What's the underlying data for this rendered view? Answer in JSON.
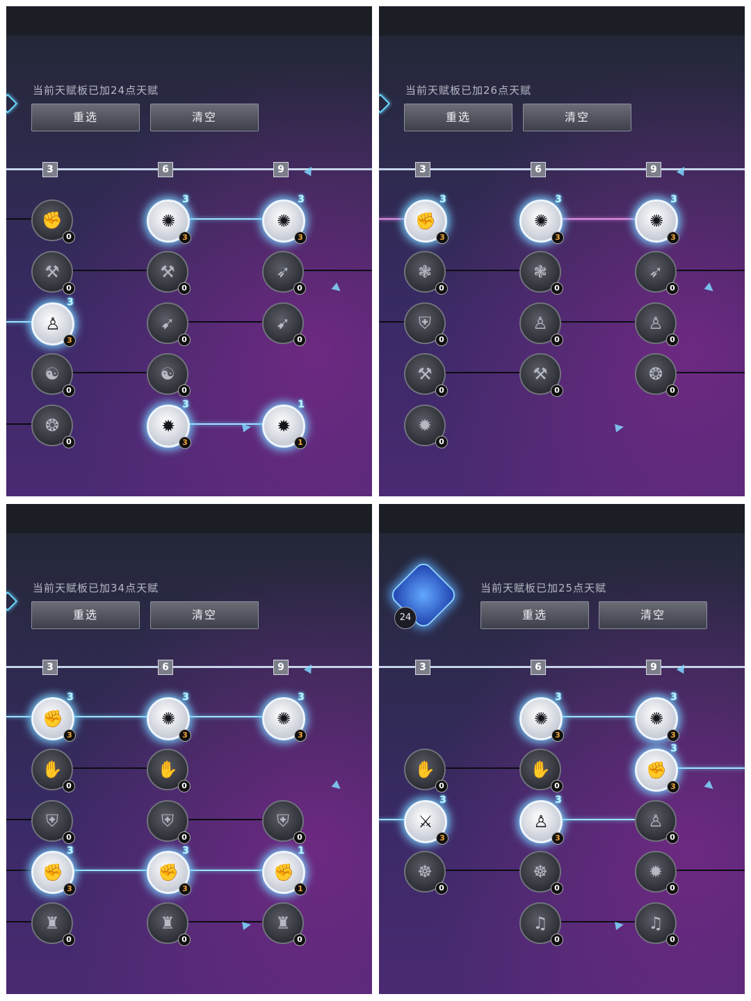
{
  "panels": [
    {
      "id": "p1",
      "talent_total": "当前天赋板已加24点天赋",
      "reselect_label": "重选",
      "clear_label": "清空",
      "tiers": [
        "3",
        "6",
        "9"
      ],
      "has_emblem": false,
      "rows": [
        {
          "nodes": [
            {
              "col": 0,
              "icon": "fist-icon",
              "points": "0",
              "max": ""
            },
            {
              "col": 1,
              "icon": "thorn-burst-icon",
              "points": "3",
              "max": "3"
            },
            {
              "col": 2,
              "icon": "thorn-burst-icon",
              "points": "3",
              "max": "3"
            }
          ],
          "links": [
            {
              "from": 1,
              "to": 2,
              "style": "glow"
            }
          ],
          "in": true
        },
        {
          "nodes": [
            {
              "col": 0,
              "icon": "dash-strike-icon",
              "points": "0",
              "max": ""
            },
            {
              "col": 1,
              "icon": "dash-strike-icon",
              "points": "0",
              "max": ""
            },
            {
              "col": 2,
              "icon": "sweep-icon",
              "points": "0",
              "max": ""
            }
          ],
          "links": [
            {
              "from": 0,
              "to": 1,
              "style": "dark"
            }
          ],
          "out": true
        },
        {
          "nodes": [
            {
              "col": 0,
              "icon": "meditate-icon",
              "points": "3",
              "max": "3"
            },
            {
              "col": 1,
              "icon": "arrow-target-icon",
              "points": "0",
              "max": ""
            },
            {
              "col": 2,
              "icon": "arrow-target-icon",
              "points": "0",
              "max": ""
            }
          ],
          "links": [
            {
              "from": 1,
              "to": 2,
              "style": "dark"
            }
          ],
          "in": true,
          "in_style": "glow"
        },
        {
          "nodes": [
            {
              "col": 0,
              "icon": "whirl-icon",
              "points": "0",
              "max": ""
            },
            {
              "col": 1,
              "icon": "whirl-icon",
              "points": "0",
              "max": ""
            }
          ],
          "links": [
            {
              "from": 0,
              "to": 1,
              "style": "dark"
            }
          ]
        },
        {
          "nodes": [
            {
              "col": 0,
              "icon": "cycle-icon",
              "points": "0",
              "max": ""
            },
            {
              "col": 1,
              "icon": "impact-icon",
              "points": "3",
              "max": "3"
            },
            {
              "col": 2,
              "icon": "impact-icon",
              "points": "1",
              "max": "1"
            }
          ],
          "links": [
            {
              "from": 1,
              "to": 2,
              "style": "glow"
            }
          ],
          "in": true
        }
      ]
    },
    {
      "id": "p2",
      "talent_total": "当前天赋板已加26点天赋",
      "reselect_label": "重选",
      "clear_label": "清空",
      "tiers": [
        "3",
        "6",
        "9"
      ],
      "has_emblem": false,
      "rows": [
        {
          "nodes": [
            {
              "col": 0,
              "icon": "fist-icon",
              "points": "3",
              "max": "3"
            },
            {
              "col": 1,
              "icon": "thorn-burst-icon",
              "points": "3",
              "max": "3"
            },
            {
              "col": 2,
              "icon": "thorn-burst-icon",
              "points": "3",
              "max": "3"
            }
          ],
          "links": [
            {
              "from": 1,
              "to": 2,
              "style": "pink"
            }
          ],
          "in": true,
          "in_style": "pink"
        },
        {
          "nodes": [
            {
              "col": 0,
              "icon": "splash-icon",
              "points": "0",
              "max": ""
            },
            {
              "col": 1,
              "icon": "splash-icon",
              "points": "0",
              "max": ""
            },
            {
              "col": 2,
              "icon": "sweep-icon",
              "points": "0",
              "max": ""
            }
          ],
          "links": [
            {
              "from": 0,
              "to": 1,
              "style": "dark"
            }
          ],
          "out": true
        },
        {
          "nodes": [
            {
              "col": 0,
              "icon": "shield-icon",
              "points": "0",
              "max": ""
            },
            {
              "col": 1,
              "icon": "meditate-icon",
              "points": "0",
              "max": ""
            },
            {
              "col": 2,
              "icon": "meditate-icon",
              "points": "0",
              "max": ""
            }
          ],
          "links": [
            {
              "from": 1,
              "to": 2,
              "style": "dark"
            }
          ],
          "in": true
        },
        {
          "nodes": [
            {
              "col": 0,
              "icon": "dash-strike-icon",
              "points": "0",
              "max": ""
            },
            {
              "col": 1,
              "icon": "dash-strike-icon",
              "points": "0",
              "max": ""
            },
            {
              "col": 2,
              "icon": "cycle-icon",
              "points": "0",
              "max": ""
            }
          ],
          "links": [
            {
              "from": 0,
              "to": 1,
              "style": "dark"
            }
          ],
          "out": true
        },
        {
          "nodes": [
            {
              "col": 0,
              "icon": "impact-icon",
              "points": "0",
              "max": ""
            }
          ],
          "links": []
        }
      ]
    },
    {
      "id": "p3",
      "talent_total": "当前天赋板已加34点天赋",
      "reselect_label": "重选",
      "clear_label": "清空",
      "tiers": [
        "3",
        "6",
        "9"
      ],
      "has_emblem": false,
      "rows": [
        {
          "nodes": [
            {
              "col": 0,
              "icon": "fist-icon",
              "points": "3",
              "max": "3"
            },
            {
              "col": 1,
              "icon": "thorn-burst-icon",
              "points": "3",
              "max": "3"
            },
            {
              "col": 2,
              "icon": "thorn-burst-icon",
              "points": "3",
              "max": "3"
            }
          ],
          "links": [
            {
              "from": 0,
              "to": 1,
              "style": "glow"
            },
            {
              "from": 1,
              "to": 2,
              "style": "glow"
            }
          ],
          "in": true,
          "in_style": "glow"
        },
        {
          "nodes": [
            {
              "col": 0,
              "icon": "gauntlet-icon",
              "points": "0",
              "max": ""
            },
            {
              "col": 1,
              "icon": "gauntlet-icon",
              "points": "0",
              "max": ""
            }
          ],
          "links": [
            {
              "from": 0,
              "to": 1,
              "style": "dark"
            }
          ]
        },
        {
          "nodes": [
            {
              "col": 0,
              "icon": "shield-icon",
              "points": "0",
              "max": ""
            },
            {
              "col": 1,
              "icon": "shield-icon",
              "points": "0",
              "max": ""
            },
            {
              "col": 2,
              "icon": "shield-icon",
              "points": "0",
              "max": ""
            }
          ],
          "links": [
            {
              "from": 1,
              "to": 2,
              "style": "dark"
            }
          ],
          "in": true
        },
        {
          "nodes": [
            {
              "col": 0,
              "icon": "fist-icon",
              "points": "3",
              "max": "3"
            },
            {
              "col": 1,
              "icon": "fist-icon",
              "points": "3",
              "max": "3"
            },
            {
              "col": 2,
              "icon": "fist-icon",
              "points": "1",
              "max": "1"
            }
          ],
          "links": [
            {
              "from": 0,
              "to": 1,
              "style": "glow"
            },
            {
              "from": 1,
              "to": 2,
              "style": "glow"
            }
          ],
          "in": true
        },
        {
          "nodes": [
            {
              "col": 0,
              "icon": "armor-icon",
              "points": "0",
              "max": ""
            },
            {
              "col": 1,
              "icon": "armor-icon",
              "points": "0",
              "max": ""
            },
            {
              "col": 2,
              "icon": "armor-icon",
              "points": "0",
              "max": ""
            }
          ],
          "links": [
            {
              "from": 1,
              "to": 2,
              "style": "dark"
            }
          ],
          "in": true
        }
      ]
    },
    {
      "id": "p4",
      "talent_total": "当前天赋板已加25点天赋",
      "reselect_label": "重选",
      "clear_label": "清空",
      "tiers": [
        "3",
        "6",
        "9"
      ],
      "has_emblem": true,
      "emblem_count": "24",
      "rows": [
        {
          "nodes": [
            {
              "col": 1,
              "icon": "thorn-burst-icon",
              "points": "3",
              "max": "3"
            },
            {
              "col": 2,
              "icon": "thorn-burst-icon",
              "points": "3",
              "max": "3"
            }
          ],
          "links": [
            {
              "from": 0,
              "to": 1,
              "style": "glow"
            }
          ]
        },
        {
          "nodes": [
            {
              "col": 0,
              "icon": "gauntlet-icon",
              "points": "0",
              "max": ""
            },
            {
              "col": 1,
              "icon": "gauntlet-icon",
              "points": "0",
              "max": ""
            },
            {
              "col": 2,
              "icon": "fist-icon",
              "points": "3",
              "max": "3"
            }
          ],
          "links": [
            {
              "from": 0,
              "to": 1,
              "style": "dark"
            }
          ],
          "out": true,
          "out_style": "glow"
        },
        {
          "nodes": [
            {
              "col": 0,
              "icon": "crossbow-icon",
              "points": "3",
              "max": "3"
            },
            {
              "col": 1,
              "icon": "meditate-icon",
              "points": "3",
              "max": "3"
            },
            {
              "col": 2,
              "icon": "meditate-icon",
              "points": "0",
              "max": ""
            }
          ],
          "links": [
            {
              "from": 1,
              "to": 2,
              "style": "glow"
            }
          ],
          "in": true,
          "in_style": "glow"
        },
        {
          "nodes": [
            {
              "col": 0,
              "icon": "trident-icon",
              "points": "0",
              "max": ""
            },
            {
              "col": 1,
              "icon": "trident-icon",
              "points": "0",
              "max": ""
            },
            {
              "col": 2,
              "icon": "impact-icon",
              "points": "0",
              "max": ""
            }
          ],
          "links": [
            {
              "from": 0,
              "to": 1,
              "style": "dark"
            }
          ],
          "out": true
        },
        {
          "nodes": [
            {
              "col": 1,
              "icon": "music-icon",
              "points": "0",
              "max": ""
            },
            {
              "col": 2,
              "icon": "music-icon",
              "points": "0",
              "max": ""
            }
          ],
          "links": [
            {
              "from": 0,
              "to": 1,
              "style": "dark"
            }
          ]
        }
      ]
    }
  ],
  "icon_glyphs": {
    "fist-icon": "✊",
    "thorn-burst-icon": "✺",
    "dash-strike-icon": "⚒",
    "sweep-icon": "➶",
    "meditate-icon": "♙",
    "arrow-target-icon": "➹",
    "whirl-icon": "☯",
    "cycle-icon": "❂",
    "impact-icon": "✹",
    "splash-icon": "❃",
    "shield-icon": "⛨",
    "gauntlet-icon": "✋",
    "armor-icon": "♜",
    "crossbow-icon": "⚔",
    "trident-icon": "☸",
    "music-icon": "♫"
  },
  "colors": {
    "glow_link": "#9fe6ff",
    "pink_link": "#e58fe8",
    "point_count_active": "#f2a43a"
  }
}
